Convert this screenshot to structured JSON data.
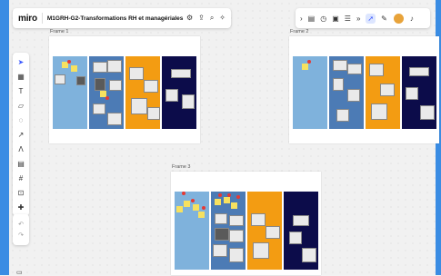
{
  "app": {
    "logo": "miro",
    "board_title": "M1GRH-G2-Transformations RH et managériales"
  },
  "topbar_icons": [
    "settings-icon",
    "share-icon",
    "search-icon",
    "magic-icon"
  ],
  "rightbar_icons": [
    "frames-icon",
    "timer-icon",
    "present-icon",
    "notes-icon",
    "more-icon",
    "cursor-icon",
    "pen-icon",
    "avatar",
    "bell-icon"
  ],
  "toolbar_icons": [
    "select-icon",
    "template-icon",
    "text-icon",
    "sticky-note-icon",
    "shapes-icon",
    "line-icon",
    "pen-icon",
    "comment-icon",
    "frame-icon",
    "upload-icon",
    "add-icon"
  ],
  "history": {
    "undo": "undo-icon",
    "redo": "redo-icon"
  },
  "frames": [
    {
      "label": "Frame 1"
    },
    {
      "label": "Frame 2"
    },
    {
      "label": "Frame 3"
    }
  ],
  "colors": {
    "blue": "#7fb2dc",
    "steel": "#4c7bb5",
    "orange": "#f39c12",
    "navy": "#0c0c4a",
    "accent": "#3d5afe"
  }
}
